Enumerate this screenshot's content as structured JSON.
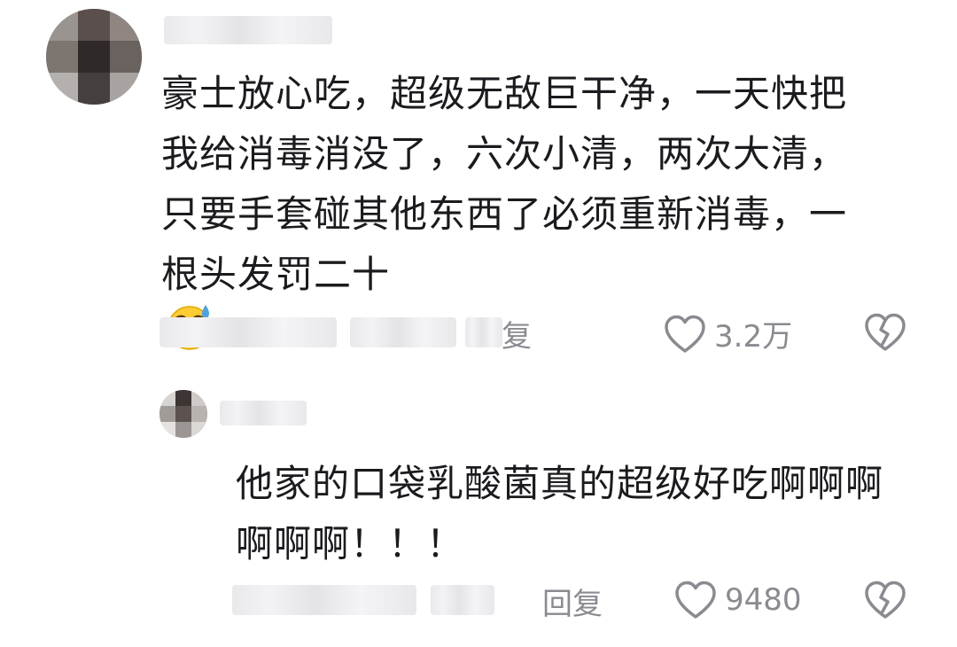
{
  "comments": [
    {
      "text_lines": [
        "豪士放心吃，超级无敌巨干净，一天快把",
        "我给消毒消没了，六次小清，两次大清，",
        "只要手套碰其他东西了必须重新消毒，一",
        "根头发罚二十"
      ],
      "emoji_icon": "grinning-sweat-emoji",
      "reply_label": "复",
      "like_count": "3.2万"
    },
    {
      "text_lines": [
        "他家的口袋乳酸菌真的超级好吃啊啊啊",
        "啊啊啊！！！"
      ],
      "reply_label": "回复",
      "like_count": "9480"
    }
  ],
  "icons": {
    "like": "heart-outline-icon",
    "dislike": "broken-heart-icon"
  },
  "colors": {
    "text": "#1b1b1f",
    "meta": "#8a8b91",
    "background": "#ffffff"
  }
}
